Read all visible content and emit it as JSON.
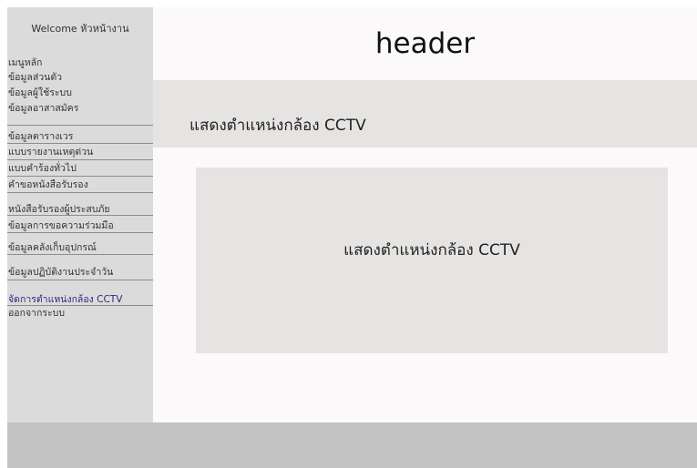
{
  "sidebar": {
    "welcome": "Welcome หัวหน้างาน",
    "items": [
      {
        "label": "เมนูหลัก"
      },
      {
        "label": "ข้อมูลส่วนตัว"
      },
      {
        "label": "ข้อมูลผู้ใช้ระบบ"
      },
      {
        "label": "ข้อมูลอาสาสมัคร"
      },
      {
        "label": "ข้อมูลตารางเวร"
      },
      {
        "label": "แบบรายงานเหตุด่วน"
      },
      {
        "label": "แบบคำร้องทั่วไป"
      },
      {
        "label": "คำขอหนังสือรับรอง"
      },
      {
        "label": "หนังสือรับรองผู้ประสบภัย"
      },
      {
        "label": "ข้อมูลการขอความร่วมมือ"
      },
      {
        "label": "ข้อมูลคลังเก็บอุปกรณ์"
      },
      {
        "label": "ข้อมูลปฏิบัติงานประจำวัน"
      },
      {
        "label": "จัดการตำแหน่งกล้อง CCTV"
      },
      {
        "label": "ออกจากระบบ"
      }
    ]
  },
  "header": {
    "title": "header"
  },
  "page": {
    "title": "แสดงตำแหน่งกล้อง CCTV",
    "content_label": "แสดงตำแหน่งกล้อง CCTV"
  }
}
